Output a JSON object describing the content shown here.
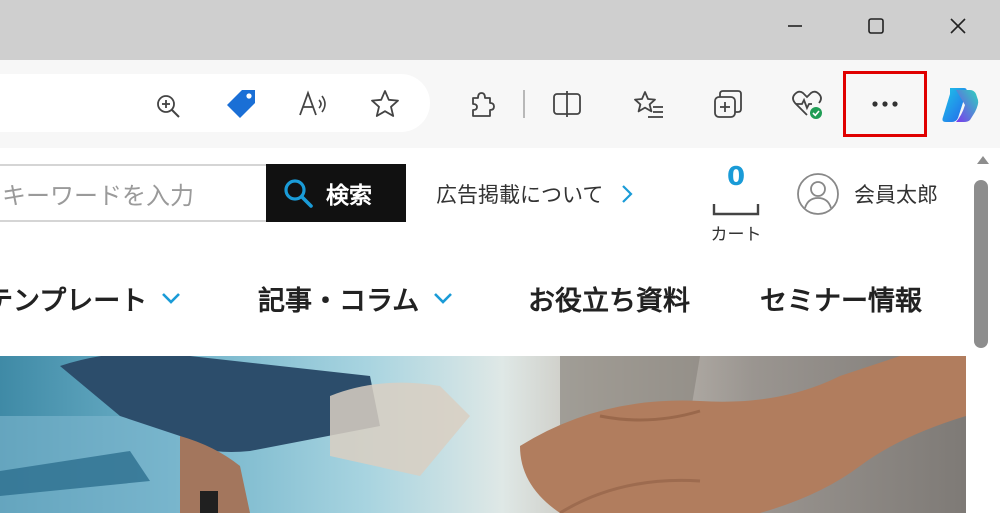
{
  "window": {
    "controls": [
      "minimize",
      "maximize",
      "close"
    ]
  },
  "toolbar": {
    "address_icons": [
      "zoom-in-icon",
      "price-tag-icon",
      "read-aloud-icon",
      "favorite-star-icon"
    ],
    "buttons": [
      "extensions-icon",
      "split-screen-icon",
      "favorites-icon",
      "collections-icon",
      "browser-essentials-icon",
      "copilot-icon"
    ],
    "more_label": "···",
    "accent_color": "#e00000",
    "brand_blue": "#1a6fd6"
  },
  "site": {
    "search": {
      "placeholder": "キーワードを入力",
      "button_label": "検索"
    },
    "ad_link": {
      "label": "広告掲載について"
    },
    "cart": {
      "count": "0",
      "label": "カート"
    },
    "member": {
      "name": "会員太郎"
    },
    "nav": [
      {
        "label": "テンプレート",
        "has_dropdown": true
      },
      {
        "label": "記事・コラム",
        "has_dropdown": true
      },
      {
        "label": "お役立ち資料",
        "has_dropdown": false
      },
      {
        "label": "セミナー情報",
        "has_dropdown": false
      }
    ],
    "accent_color": "#1a9bd7"
  }
}
